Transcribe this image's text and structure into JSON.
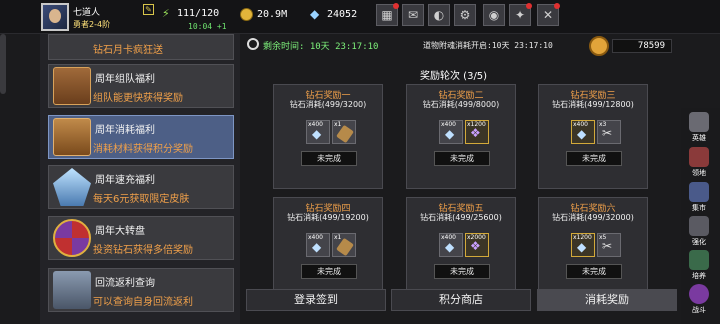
{
  "player": {
    "name": "七道人",
    "rank": "勇者2-4阶",
    "stamina": "111/120",
    "stamina_timer": "10:04 +1",
    "gold": "20.9M",
    "diamonds": "24052"
  },
  "toolbar": {
    "icons": [
      "shop-icon",
      "mail-icon",
      "gamepad-icon",
      "settings-icon",
      "color-wheel-icon",
      "quest-icon",
      "swords-icon"
    ]
  },
  "left_menu": [
    {
      "title": "钻石月卡疯狂送",
      "desc": ""
    },
    {
      "title": "周年组队福利",
      "desc": "组队能更快获得奖励"
    },
    {
      "title": "周年消耗福利",
      "desc": "消耗材料获得积分奖励"
    },
    {
      "title": "周年速充福利",
      "desc": "每天6元获取限定皮肤"
    },
    {
      "title": "周年大转盘",
      "desc": "投资钻石获得多倍奖励"
    },
    {
      "title": "回流返利查询",
      "desc": "可以查询自身回流返利"
    }
  ],
  "header": {
    "remaining_label": "剩余时间:",
    "remaining_value": "10天 23:17:10",
    "next_label": "道物附魂消耗开启:10天 23:17:10",
    "token_count": "78599",
    "round_text": "奖励轮次 (3/5)"
  },
  "cards": [
    {
      "title": "钻石奖励一",
      "sub": "钻石消耗(499/3200)",
      "r1": "x400",
      "r2": "x1",
      "btn": "未完成"
    },
    {
      "title": "钻石奖励二",
      "sub": "钻石消耗(499/8000)",
      "r1": "x400",
      "r2": "x1200",
      "btn": "未完成"
    },
    {
      "title": "钻石奖励三",
      "sub": "钻石消耗(499/12800)",
      "r1": "x400",
      "r2": "x3",
      "btn": "未完成"
    },
    {
      "title": "钻石奖励四",
      "sub": "钻石消耗(499/19200)",
      "r1": "x400",
      "r2": "x1",
      "btn": "未完成"
    },
    {
      "title": "钻石奖励五",
      "sub": "钻石消耗(499/25600)",
      "r1": "x400",
      "r2": "x2000",
      "btn": "未完成"
    },
    {
      "title": "钻石奖励六",
      "sub": "钻石消耗(499/32000)",
      "r1": "x1200",
      "r2": "x5",
      "btn": "未完成"
    }
  ],
  "tabs": [
    "登录签到",
    "积分商店",
    "消耗奖励"
  ],
  "right_menu": [
    "英雄",
    "领地",
    "集市",
    "强化",
    "培养",
    "战斗"
  ],
  "colors": {
    "accent_orange": "#f0a04a",
    "timer_green": "#7df07a",
    "selected_blue": "#4d5f86"
  }
}
